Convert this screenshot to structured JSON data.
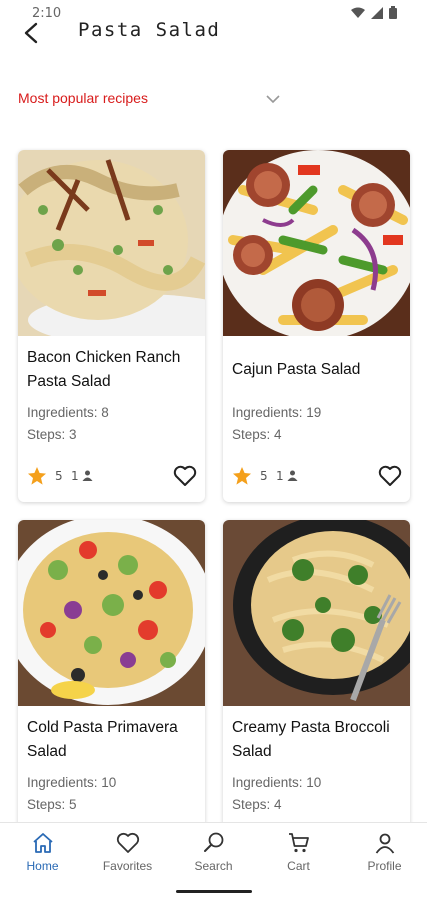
{
  "status": {
    "time": "2:10"
  },
  "header": {
    "title": "Pasta Salad"
  },
  "filter": {
    "label": "Most popular recipes"
  },
  "recipes": [
    {
      "title": "Bacon Chicken Ranch Pasta Salad",
      "ingredients": "Ingredients: 8",
      "steps": "Steps: 3",
      "rating": "5",
      "ratings_count": "1"
    },
    {
      "title": "Cajun Pasta Salad",
      "ingredients": "Ingredients: 19",
      "steps": "Steps: 4",
      "rating": "5",
      "ratings_count": "1"
    },
    {
      "title": "Cold Pasta Primavera Salad",
      "ingredients": "Ingredients: 10",
      "steps": "Steps: 5"
    },
    {
      "title": "Creamy Pasta Broccoli Salad",
      "ingredients": "Ingredients: 10",
      "steps": "Steps: 4"
    }
  ],
  "nav": [
    {
      "label": "Home",
      "icon": "home-icon",
      "active": true
    },
    {
      "label": "Favorites",
      "icon": "heart-icon"
    },
    {
      "label": "Search",
      "icon": "search-icon"
    },
    {
      "label": "Cart",
      "icon": "cart-icon"
    },
    {
      "label": "Profile",
      "icon": "profile-icon"
    }
  ],
  "colors": {
    "accent": "#d81b1b",
    "star": "#f4a01c",
    "nav_active": "#2a6ab5"
  }
}
